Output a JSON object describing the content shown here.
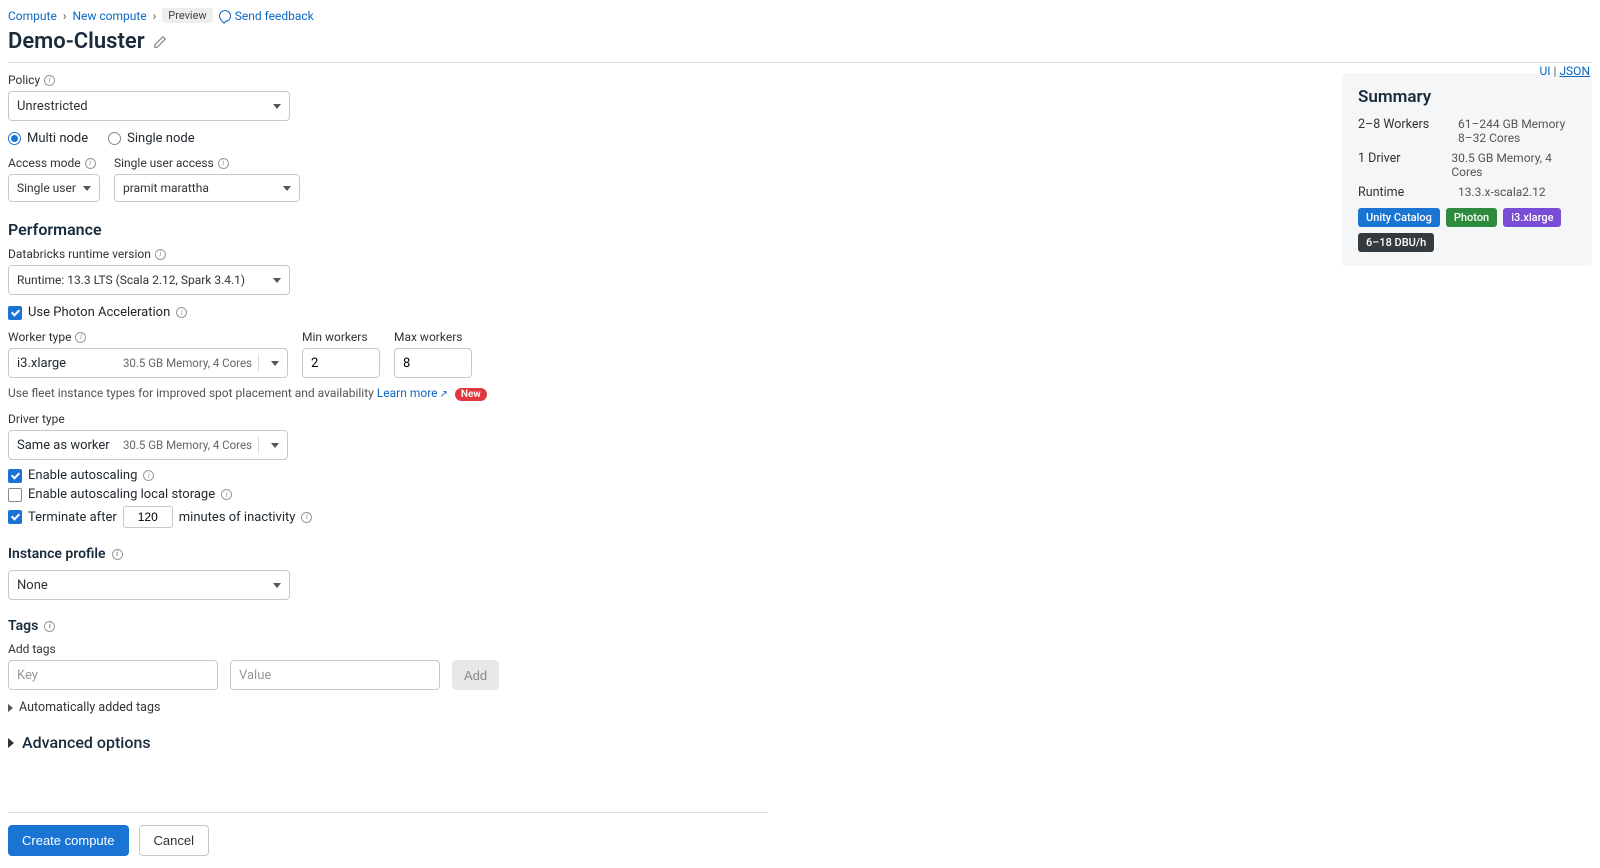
{
  "breadcrumb": {
    "compute": "Compute",
    "new_compute": "New compute",
    "preview": "Preview",
    "feedback": "Send feedback"
  },
  "title": "Demo-Cluster",
  "view_toggle": {
    "ui": "UI",
    "json": "JSON"
  },
  "policy": {
    "label": "Policy",
    "value": "Unrestricted"
  },
  "node_mode": {
    "multi": "Multi node",
    "single": "Single node"
  },
  "access": {
    "mode_label": "Access mode",
    "mode_value": "Single user",
    "user_label": "Single user access",
    "user_value": "pramit marattha"
  },
  "performance": {
    "title": "Performance",
    "runtime_label": "Databricks runtime version",
    "runtime_value": "Runtime: 13.3 LTS (Scala 2.12, Spark 3.4.1)",
    "photon_label": "Use Photon Acceleration",
    "worker_type_label": "Worker type",
    "worker_type_value": "i3.xlarge",
    "worker_type_meta": "30.5 GB Memory, 4 Cores",
    "min_workers_label": "Min workers",
    "min_workers_value": "2",
    "max_workers_label": "Max workers",
    "max_workers_value": "8",
    "fleet_hint": "Use fleet instance types for improved spot placement and availability",
    "learn_more": "Learn more",
    "new_badge": "New",
    "driver_label": "Driver type",
    "driver_value": "Same as worker",
    "driver_meta": "30.5 GB Memory, 4 Cores",
    "enable_autoscaling": "Enable autoscaling",
    "enable_autoscaling_storage": "Enable autoscaling local storage",
    "terminate_prefix": "Terminate after",
    "terminate_value": "120",
    "terminate_suffix": "minutes of inactivity"
  },
  "instance_profile": {
    "title": "Instance profile",
    "value": "None"
  },
  "tags": {
    "title": "Tags",
    "add_label": "Add tags",
    "key_placeholder": "Key",
    "value_placeholder": "Value",
    "add_btn": "Add",
    "auto_tags": "Automatically added tags"
  },
  "advanced": "Advanced options",
  "summary": {
    "title": "Summary",
    "workers_k": "2–8 Workers",
    "workers_v1": "61–244 GB Memory",
    "workers_v2": "8–32 Cores",
    "driver_k": "1 Driver",
    "driver_v": "30.5 GB Memory, 4 Cores",
    "runtime_k": "Runtime",
    "runtime_v": "13.3.x-scala2.12",
    "badges": {
      "uc": "Unity Catalog",
      "photon": "Photon",
      "itype": "i3.xlarge",
      "dbu": "6–18 DBU/h"
    }
  },
  "footer": {
    "create": "Create compute",
    "cancel": "Cancel"
  }
}
